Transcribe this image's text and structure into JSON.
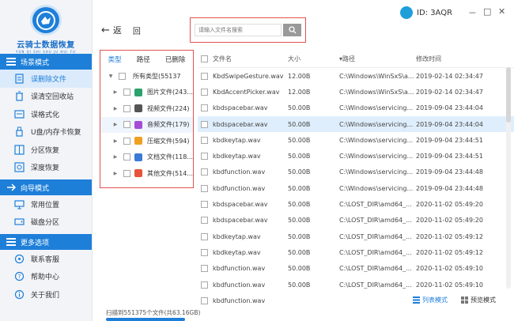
{
  "app": {
    "logo_title": "云骑士数据恢复",
    "logo_sub": "YUN QI SHI SHU JU HUI FU",
    "user_id": "ID: 3AQR",
    "minimize": "－",
    "restore": "□",
    "close": "✕"
  },
  "sidebar": {
    "sections": [
      {
        "title": "场景模式",
        "items": [
          "误删除文件",
          "误清空回收站",
          "误格式化",
          "U盘/内存卡恢复",
          "分区恢复",
          "深度恢复"
        ]
      },
      {
        "title": "向导模式",
        "items": [
          "常用位置",
          "磁盘分区"
        ]
      },
      {
        "title": "更多选项",
        "items": [
          "联系客服",
          "帮助中心",
          "关于我们"
        ]
      }
    ]
  },
  "toolbar": {
    "back_label": "返",
    "root_label": "回",
    "search_placeholder": "请输入文件名搜索"
  },
  "tree": {
    "tabs": [
      "类型",
      "路径",
      "已删除"
    ],
    "root_label": "所有类型(55137",
    "items": [
      {
        "label": "图片文件(243...",
        "icon": "image-icon",
        "color": "#2aa26d"
      },
      {
        "label": "视频文件(224)",
        "icon": "video-icon",
        "color": "#555555"
      },
      {
        "label": "音频文件(179)",
        "icon": "audio-icon",
        "color": "#a54bd8"
      },
      {
        "label": "压缩文件(594)",
        "icon": "archive-icon",
        "color": "#f0a020"
      },
      {
        "label": "文档文件(118...",
        "icon": "document-icon",
        "color": "#3a7bd5"
      },
      {
        "label": "其他文件(514...",
        "icon": "other-icon",
        "color": "#e8533b"
      }
    ]
  },
  "table": {
    "headers": {
      "name": "文件名",
      "size": "大小",
      "path": "▾路径",
      "time": "修改时间"
    },
    "rows": [
      {
        "name": "KbdSwipeGesture.wav",
        "size": "12.00B",
        "path": "C:\\Windows\\WinSxS\\a...",
        "time": "2019-02-14 02:34:47"
      },
      {
        "name": "KbdAccentPicker.wav",
        "size": "12.00B",
        "path": "C:\\Windows\\WinSxS\\a...",
        "time": "2019-02-14 02:34:47"
      },
      {
        "name": "kbdspacebar.wav",
        "size": "50.00B",
        "path": "C:\\Windows\\servicing...",
        "time": "2019-09-04 23:44:04"
      },
      {
        "name": "kbdspacebar.wav",
        "size": "50.00B",
        "path": "C:\\Windows\\servicing...",
        "time": "2019-09-04 23:44:04"
      },
      {
        "name": "kbdkeytap.wav",
        "size": "50.00B",
        "path": "C:\\Windows\\servicing...",
        "time": "2019-09-04 23:44:51"
      },
      {
        "name": "kbdkeytap.wav",
        "size": "50.00B",
        "path": "C:\\Windows\\servicing...",
        "time": "2019-09-04 23:44:51"
      },
      {
        "name": "kbdfunction.wav",
        "size": "50.00B",
        "path": "C:\\Windows\\servicing...",
        "time": "2019-09-04 23:44:48"
      },
      {
        "name": "kbdfunction.wav",
        "size": "50.00B",
        "path": "C:\\Windows\\servicing...",
        "time": "2019-09-04 23:44:48"
      },
      {
        "name": "kbdspacebar.wav",
        "size": "50.00B",
        "path": "C:\\LOST_DIR\\amd64_...",
        "time": "2020-11-02 05:49:20"
      },
      {
        "name": "kbdspacebar.wav",
        "size": "50.00B",
        "path": "C:\\LOST_DIR\\amd64_...",
        "time": "2020-11-02 05:49:20"
      },
      {
        "name": "kbdkeytap.wav",
        "size": "50.00B",
        "path": "C:\\LOST_DIR\\amd64_...",
        "time": "2020-11-02 05:49:12"
      },
      {
        "name": "kbdkeytap.wav",
        "size": "50.00B",
        "path": "C:\\LOST_DIR\\amd64_...",
        "time": "2020-11-02 05:49:12"
      },
      {
        "name": "kbdfunction.wav",
        "size": "50.00B",
        "path": "C:\\LOST_DIR\\amd64_...",
        "time": "2020-11-02 05:49:10"
      },
      {
        "name": "kbdfunction.wav",
        "size": "50.00B",
        "path": "C:\\LOST_DIR\\amd64_...",
        "time": "2020-11-02 05:49:10"
      },
      {
        "name": "kbdfunction.wav",
        "size": "",
        "path": "",
        "time": ""
      }
    ]
  },
  "footer": {
    "scan_status": "扫描到551375个文件(共63.16GB)",
    "list_view": "列表模式",
    "preview_view": "预览模式"
  },
  "colors": {
    "accent": "#1e7fd9",
    "highlight_border": "#e05252"
  }
}
